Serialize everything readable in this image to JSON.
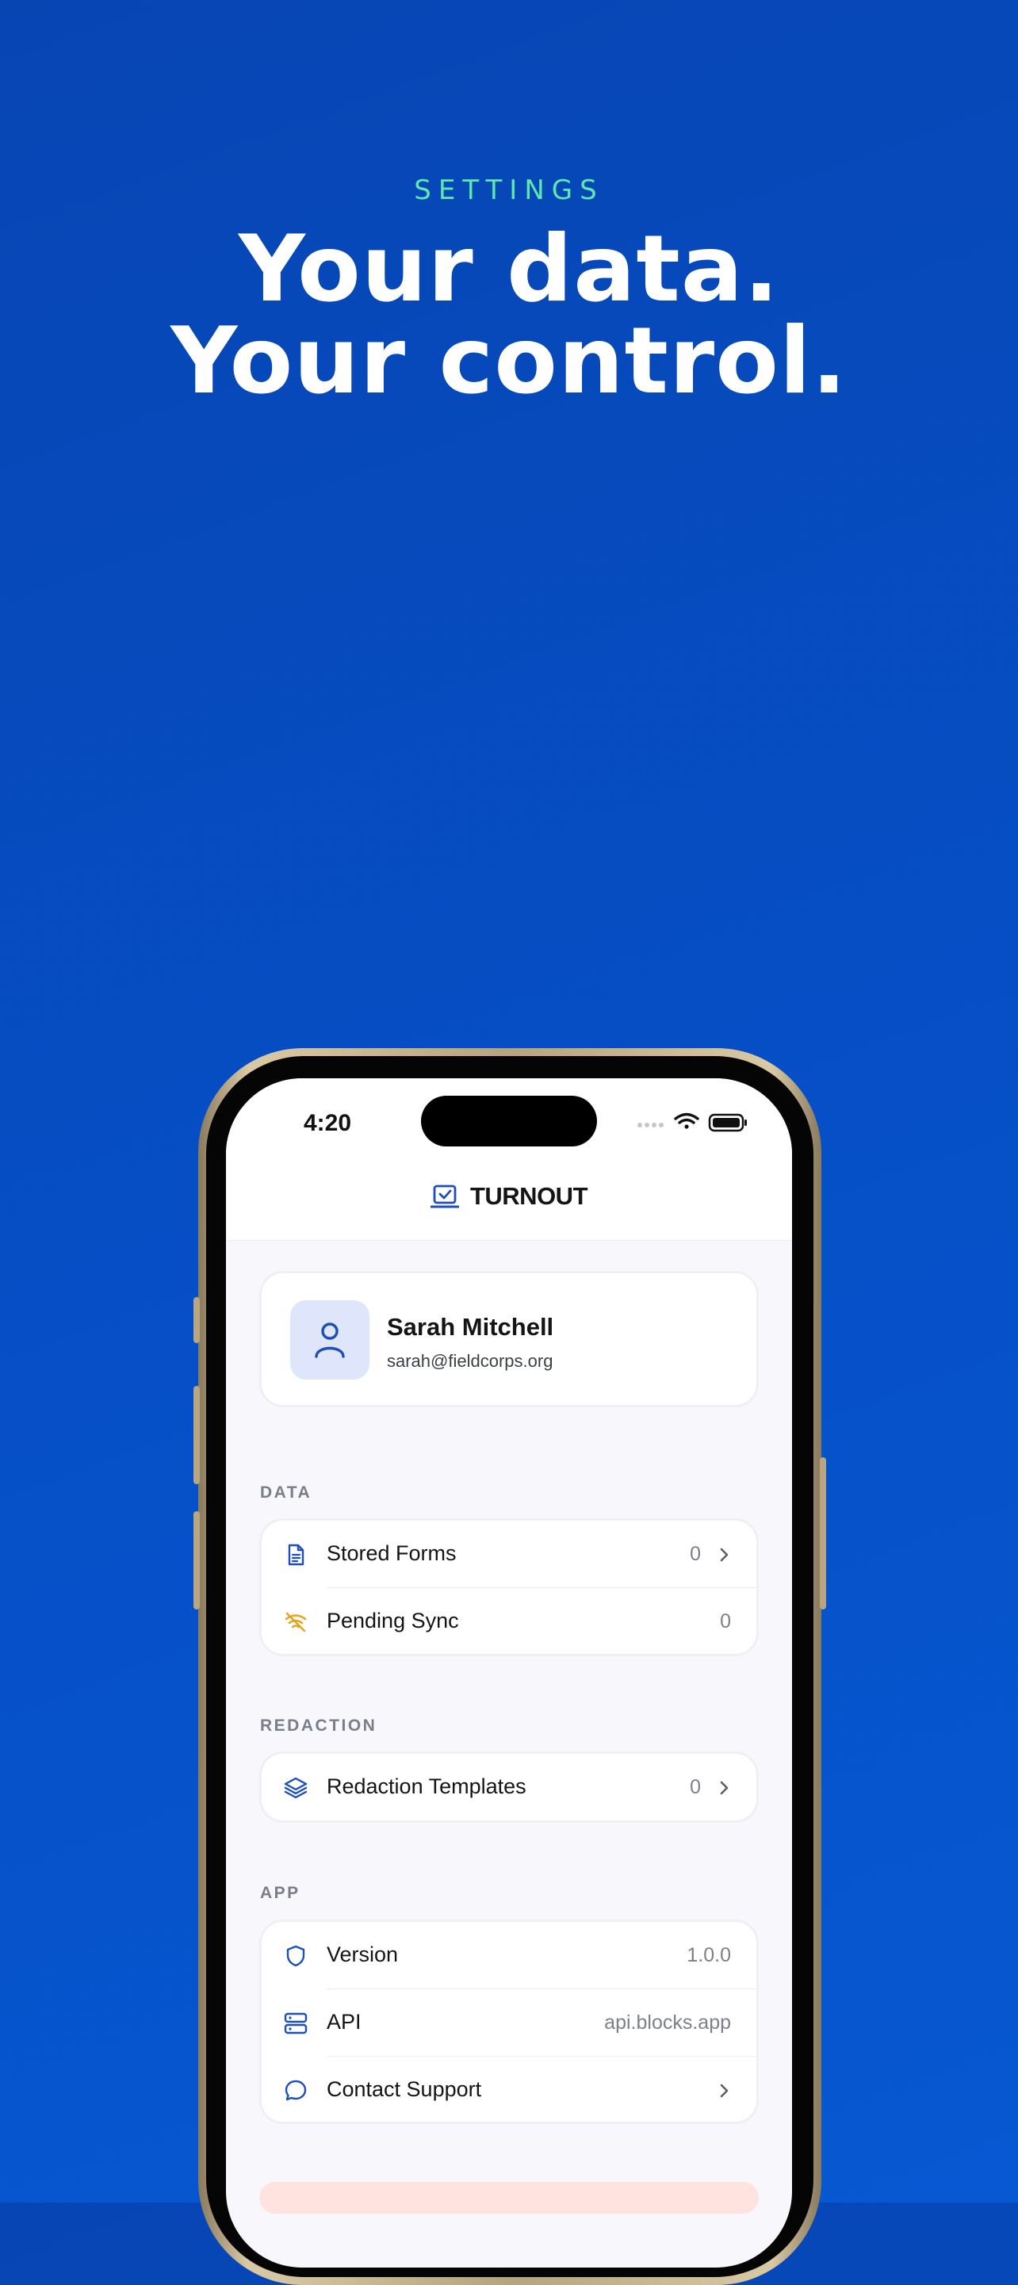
{
  "hero": {
    "eyebrow": "SETTINGS",
    "headline_line1": "Your data.",
    "headline_line2": "Your control."
  },
  "status_bar": {
    "time": "4:20"
  },
  "app": {
    "brand": "TURNOUT"
  },
  "profile": {
    "name": "Sarah Mitchell",
    "email": "sarah@fieldcorps.org"
  },
  "sections": {
    "data": {
      "label": "DATA",
      "rows": [
        {
          "label": "Stored Forms",
          "value": "0",
          "icon": "document-icon"
        },
        {
          "label": "Pending Sync",
          "value": "0",
          "icon": "wifi-off-icon"
        }
      ]
    },
    "redaction": {
      "label": "REDACTION",
      "rows": [
        {
          "label": "Redaction Templates",
          "value": "0",
          "icon": "layers-icon"
        }
      ]
    },
    "app": {
      "label": "APP",
      "rows": [
        {
          "label": "Version",
          "value": "1.0.0",
          "icon": "shield-icon"
        },
        {
          "label": "API",
          "value": "api.blocks.app",
          "icon": "server-icon"
        },
        {
          "label": "Contact Support",
          "value": "",
          "icon": "chat-icon"
        }
      ]
    }
  },
  "colors": {
    "accent": "#1e4fb8",
    "warning": "#e6a21a",
    "eyebrow": "#5de8b0"
  }
}
